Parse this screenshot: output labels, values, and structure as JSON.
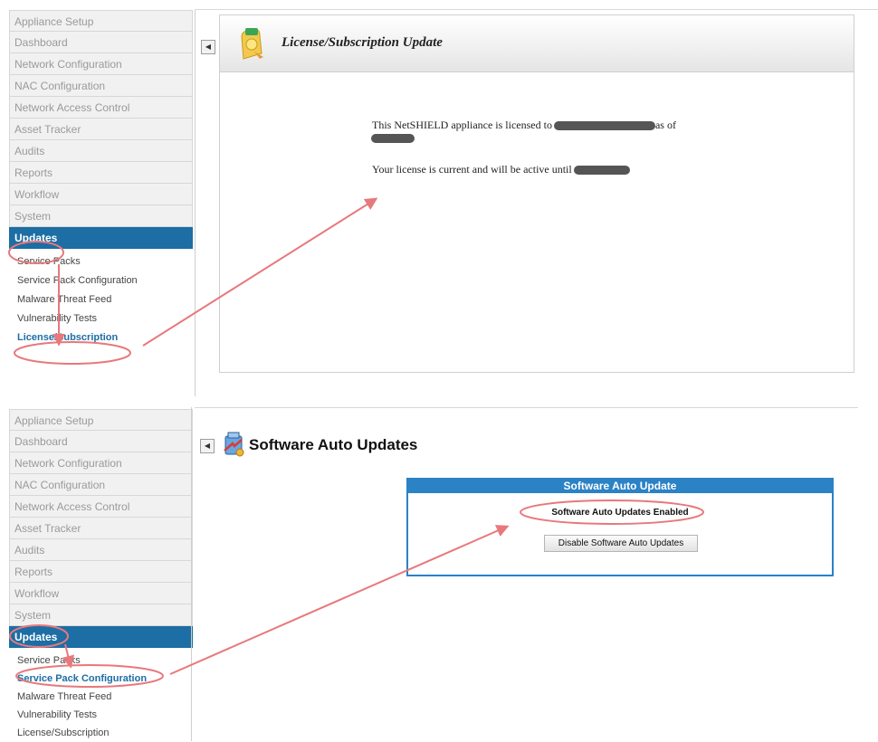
{
  "top": {
    "sidebar": {
      "items": [
        "Appliance Setup",
        "Dashboard",
        "Network Configuration",
        "NAC Configuration",
        "Network Access Control",
        "Asset Tracker",
        "Audits",
        "Reports",
        "Workflow",
        "System",
        "Updates"
      ],
      "active": "Updates",
      "subitems": [
        "Service Packs",
        "Service Pack Configuration",
        "Malware Threat Feed",
        "Vulnerability Tests",
        "License/Subscription"
      ],
      "selected": "License/Subscription"
    },
    "page_title": "License/Subscription Update",
    "license_line1_start": "This NetSHIELD appliance is licensed to",
    "license_line1_end": "as of",
    "license_line2": "Your license is current and will be active until"
  },
  "bottom": {
    "sidebar": {
      "items": [
        "Appliance Setup",
        "Dashboard",
        "Network Configuration",
        "NAC Configuration",
        "Network Access Control",
        "Asset Tracker",
        "Audits",
        "Reports",
        "Workflow",
        "System",
        "Updates"
      ],
      "active": "Updates",
      "subitems": [
        "Service Packs",
        "Service Pack Configuration",
        "Malware Threat Feed",
        "Vulnerability Tests",
        "License/Subscription"
      ],
      "selected": "Service Pack Configuration"
    },
    "page_title": "Software Auto Updates",
    "box_header": "Software Auto Update",
    "status": "Software Auto Updates Enabled",
    "disable_button": "Disable Software Auto Updates"
  },
  "colors": {
    "accent": "#1c6ea4",
    "box_border": "#2b82c5",
    "annotation": "#e8787c"
  },
  "icons": [
    "collapse-arrow-icon",
    "license-icon",
    "software-update-icon"
  ]
}
